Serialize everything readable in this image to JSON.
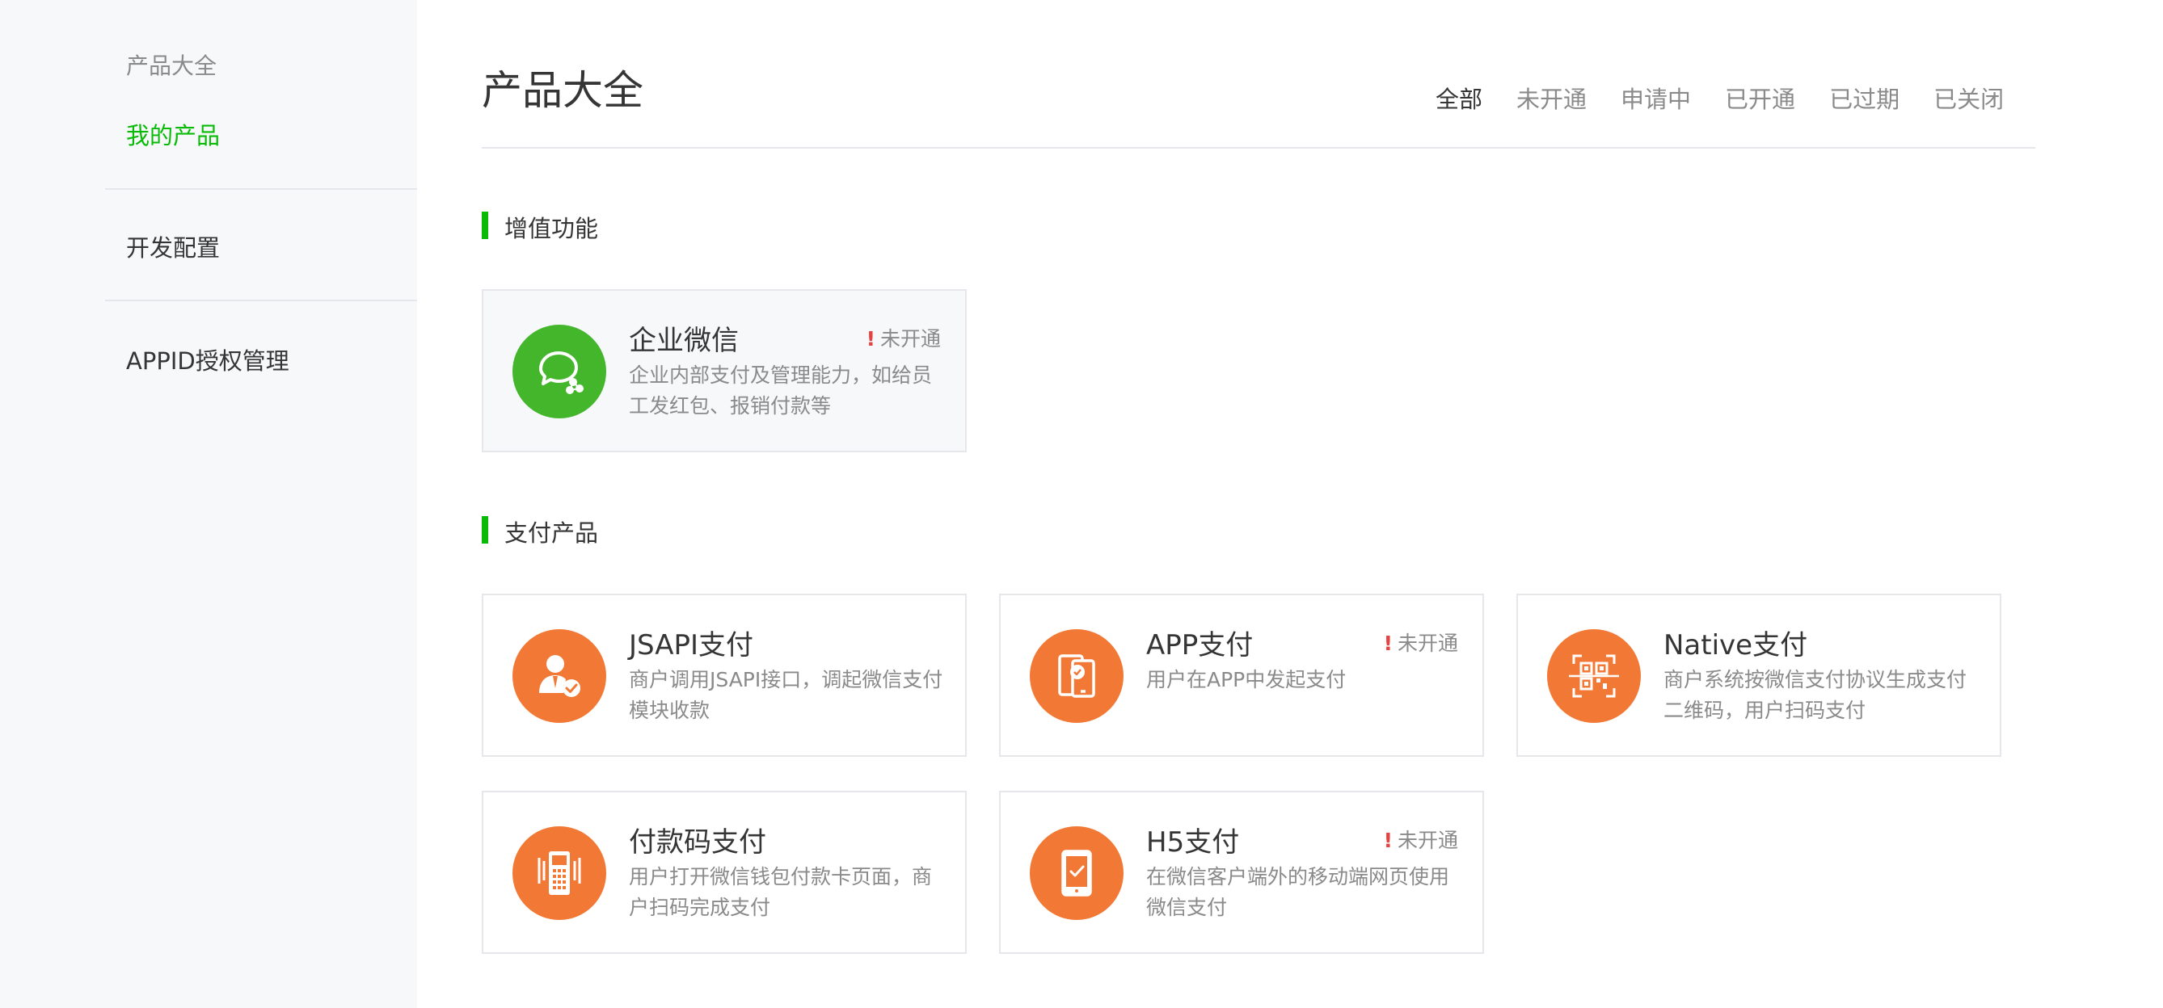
{
  "sidebar": {
    "heading": "产品大全",
    "active_item": "我的产品",
    "items": [
      "开发配置",
      "APPID授权管理"
    ]
  },
  "header": {
    "title": "产品大全",
    "tabs": [
      "全部",
      "未开通",
      "申请中",
      "已开通",
      "已过期",
      "已关闭"
    ],
    "active_tab": "全部"
  },
  "sections": [
    {
      "title": "增值功能",
      "cards": [
        {
          "name": "企业微信",
          "status": "未开通",
          "desc": "企业内部支付及管理能力，如给员工发红包、报销付款等",
          "icon": "wework-chat-icon",
          "icon_color": "#43b62c"
        }
      ]
    },
    {
      "title": "支付产品",
      "cards": [
        {
          "name": "JSAPI支付",
          "status": "",
          "desc": "商户调用JSAPI接口，调起微信支付模块收款",
          "icon": "person-check-icon",
          "icon_color": "#f27935"
        },
        {
          "name": "APP支付",
          "status": "未开通",
          "desc": "用户在APP中发起支付",
          "icon": "phone-pay-icon",
          "icon_color": "#f27935"
        },
        {
          "name": "Native支付",
          "status": "",
          "desc": "商户系统按微信支付协议生成支付二维码，用户扫码支付",
          "icon": "qrcode-icon",
          "icon_color": "#f27935"
        },
        {
          "name": "付款码支付",
          "status": "",
          "desc": "用户打开微信钱包付款卡页面，商户扫码完成支付",
          "icon": "pos-terminal-icon",
          "icon_color": "#f27935"
        },
        {
          "name": "H5支付",
          "status": "未开通",
          "desc": "在微信客户端外的移动端网页使用微信支付",
          "icon": "mobile-check-icon",
          "icon_color": "#f27935"
        }
      ]
    }
  ],
  "colors": {
    "accent": "#09bb07",
    "warning": "#e64340",
    "orange": "#f27935"
  }
}
